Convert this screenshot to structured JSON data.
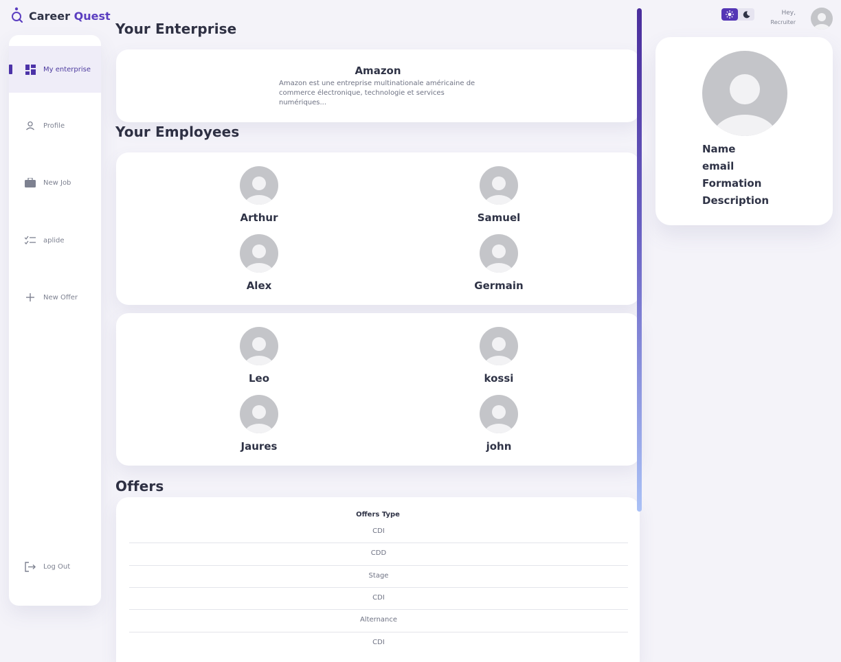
{
  "brand": {
    "name_part1": "Career",
    "name_part2": "Quest"
  },
  "colors": {
    "accent": "#5b3ec0",
    "background": "#f4f3f9",
    "card": "#ffffff"
  },
  "sidebar": {
    "items": [
      {
        "label": "My enterprise",
        "icon": "dashboard-icon",
        "active": true
      },
      {
        "label": "Profile",
        "icon": "user-icon"
      },
      {
        "label": "New Job",
        "icon": "briefcase-icon"
      },
      {
        "label": "aplide",
        "icon": "checklist-icon"
      },
      {
        "label": "New Offer",
        "icon": "plus-icon"
      }
    ],
    "logout": {
      "label": "Log Out",
      "icon": "logout-icon"
    }
  },
  "enterprise": {
    "section_title": "Your Enterprise",
    "name": "Amazon",
    "description": "Amazon est une entreprise multinationale américaine de commerce électronique, technologie et services numériques..."
  },
  "employees": {
    "section_title": "Your Employees",
    "groups": [
      [
        "Arthur",
        "Samuel",
        "Alex",
        "Germain"
      ],
      [
        "Leo",
        "kossi",
        "Jaures",
        "john"
      ]
    ]
  },
  "offers": {
    "section_title": "Offers",
    "column_header": "Offers Type",
    "rows": [
      "CDI",
      "CDD",
      "Stage",
      "CDI",
      "Alternance",
      "CDI"
    ]
  },
  "header": {
    "greeting": "Hey,",
    "role": "Recruiter",
    "theme_toggle": {
      "light_icon": "sun-icon",
      "dark_icon": "moon-icon",
      "selected": "light"
    }
  },
  "profile_card": {
    "fields": [
      "Name",
      "email",
      "Formation",
      "Description"
    ]
  }
}
